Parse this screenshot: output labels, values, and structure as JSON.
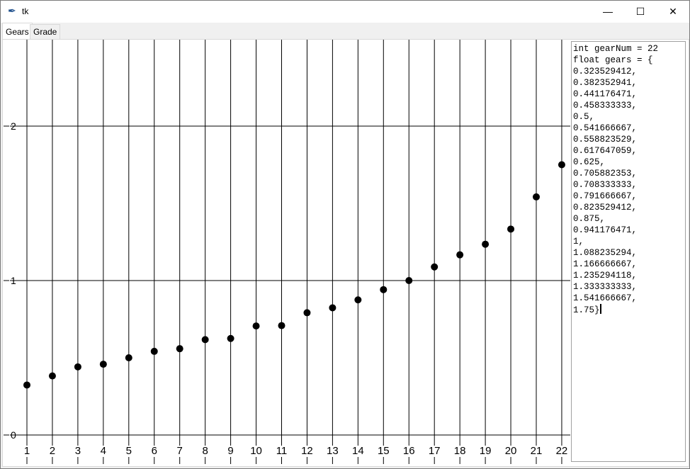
{
  "window": {
    "title": "tk",
    "icon": "feather-icon",
    "controls": [
      "minimize-icon",
      "maximize-icon",
      "close-icon"
    ]
  },
  "tabs": [
    {
      "label": "Gears",
      "active": true
    },
    {
      "label": "Grade",
      "active": false
    }
  ],
  "chart_data": {
    "type": "scatter",
    "x": [
      1,
      2,
      3,
      4,
      5,
      6,
      7,
      8,
      9,
      10,
      11,
      12,
      13,
      14,
      15,
      16,
      17,
      18,
      19,
      20,
      21,
      22
    ],
    "values": [
      0.323529412,
      0.382352941,
      0.441176471,
      0.458333333,
      0.5,
      0.541666667,
      0.558823529,
      0.617647059,
      0.625,
      0.705882353,
      0.708333333,
      0.791666667,
      0.823529412,
      0.875,
      0.941176471,
      1,
      1.088235294,
      1.166666667,
      1.235294118,
      1.333333333,
      1.541666667,
      1.75
    ],
    "x_ticks": [
      "1",
      "2",
      "3",
      "4",
      "5",
      "6",
      "7",
      "8",
      "9",
      "10",
      "11",
      "12",
      "13",
      "14",
      "15",
      "16",
      "17",
      "18",
      "19",
      "20",
      "21",
      "22"
    ],
    "y_ticks": [
      "0",
      "1",
      "2"
    ],
    "xlim": [
      1,
      22
    ],
    "ylim": [
      0,
      2.56
    ],
    "grid": true,
    "point_color": "#000000"
  },
  "code_text": {
    "lines": [
      "int gearNum = 22",
      "float gears = {",
      "0.323529412,",
      "0.382352941,",
      "0.441176471,",
      "0.458333333,",
      "0.5,",
      "0.541666667,",
      "0.558823529,",
      "0.617647059,",
      "0.625,",
      "0.705882353,",
      "0.708333333,",
      "0.791666667,",
      "0.823529412,",
      "0.875,",
      "0.941176471,",
      "1,",
      "1.088235294,",
      "1.166666667,",
      "1.235294118,",
      "1.333333333,",
      "1.541666667,",
      "1.75}"
    ]
  }
}
